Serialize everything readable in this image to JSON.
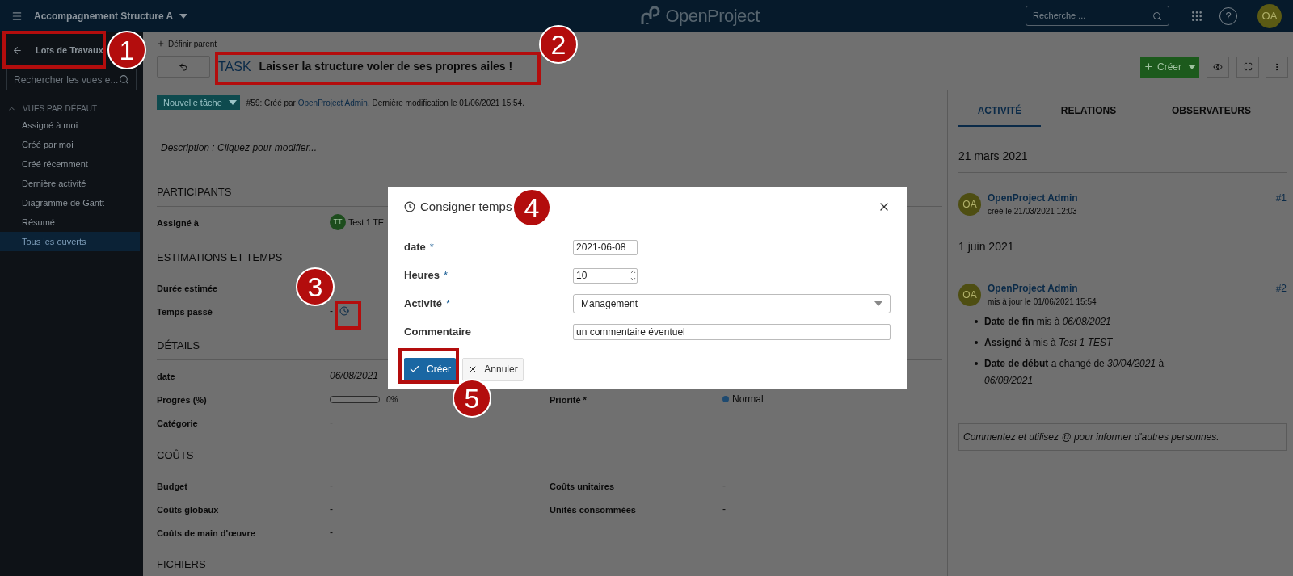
{
  "header": {
    "project": "Accompagnement Structure A",
    "logo_text": "OpenProject",
    "search": {
      "placeholder": "Recherche ..."
    },
    "help": "?",
    "avatar": "OA"
  },
  "sidebar": {
    "title": "Lots de Travaux",
    "search": {
      "placeholder": "Rechercher les vues e..."
    },
    "group": {
      "label": "VUES PAR DÉFAUT",
      "expanded": true
    },
    "items": [
      {
        "label": "Assigné à moi",
        "selected": false
      },
      {
        "label": "Créé par moi",
        "selected": false
      },
      {
        "label": "Créé récemment",
        "selected": false
      },
      {
        "label": "Dernière activité",
        "selected": false
      },
      {
        "label": "Diagramme de Gantt",
        "selected": false
      },
      {
        "label": "Résumé",
        "selected": false
      },
      {
        "label": "Tous les ouverts",
        "selected": true
      }
    ]
  },
  "work_package": {
    "set_parent": "Définir parent",
    "type": "TASK",
    "title": "Laisser la structure voler de ses propres ailes !",
    "create_button": "Créer",
    "status": "Nouvelle tâche",
    "meta_prefix": "#59: Créé par ",
    "meta_author": "OpenProject Admin",
    "meta_suffix": ". Dernière modification le 01/06/2021 15:54.",
    "description": "Description : Cliquez pour modifier...",
    "sections": [
      {
        "title": "PARTICIPANTS",
        "rows": [
          {
            "left": {
              "label": "Assigné à",
              "kind": "user",
              "initials": "TT",
              "value": "Test 1 TE"
            }
          }
        ]
      },
      {
        "title": "ESTIMATIONS ET TEMPS",
        "rows": [
          {
            "left": {
              "label": "Durée estimée",
              "kind": "empty"
            }
          },
          {
            "left": {
              "label": "Temps passé",
              "kind": "time",
              "value": "-"
            }
          }
        ]
      },
      {
        "title": "DÉTAILS",
        "rows": [
          {
            "left": {
              "label": "date",
              "kind": "date",
              "value": "06/08/2021 -"
            }
          },
          {
            "left": {
              "label": "Progrès (%)",
              "kind": "progress",
              "level": 0,
              "reading": "0%"
            },
            "right": {
              "label": "Priorité *",
              "kind": "priority",
              "value": "Normal",
              "color": "#1e4a70"
            }
          },
          {
            "left": {
              "label": "Catégorie",
              "kind": "text",
              "value": "-"
            }
          }
        ]
      },
      {
        "title": "COÛTS",
        "rows": [
          {
            "left": {
              "label": "Budget",
              "kind": "text",
              "value": "-"
            },
            "right": {
              "label": "Coûts unitaires",
              "kind": "text",
              "value": "-"
            }
          },
          {
            "left": {
              "label": "Coûts globaux",
              "kind": "text",
              "value": "-"
            },
            "right": {
              "label": "Unités consommées",
              "kind": "text",
              "value": "-"
            }
          },
          {
            "left": {
              "label": "Coûts de main d'œuvre",
              "kind": "text",
              "value": "-"
            }
          }
        ]
      },
      {
        "title": "FICHIERS"
      }
    ]
  },
  "activity": {
    "tabs": [
      {
        "label": "ACTIVITÉ",
        "selected": true
      },
      {
        "label": "RELATIONS",
        "selected": false
      },
      {
        "label": "OBSERVATEURS",
        "selected": false
      }
    ],
    "days": [
      {
        "date": "21 mars 2021",
        "entries": [
          {
            "initials": "OA",
            "author": "OpenProject Admin",
            "meta": "créé le 21/03/2021 12:03",
            "number": "#1"
          }
        ]
      },
      {
        "date": "1 juin 2021",
        "entries": [
          {
            "initials": "OA",
            "author": "OpenProject Admin",
            "meta": "mis à jour le 01/06/2021 15:54",
            "number": "#2",
            "changes": [
              "**Date de fin** mis à *06/08/2021*",
              "**Assigné à** mis à *Test 1 TEST*",
              "**Date de début** a changé de *30/04/2021* à *06/08/2021*"
            ]
          }
        ]
      }
    ],
    "comment": {
      "placeholder": "Commentez et utilisez @ pour informer d'autres personnes."
    }
  },
  "modal": {
    "title": "Consigner temps",
    "required_mark": "*",
    "fields": [
      {
        "label": "date",
        "required": true,
        "kind": "date",
        "value": "2021-06-08"
      },
      {
        "label": "Heures",
        "required": true,
        "kind": "number",
        "value": "10"
      },
      {
        "label": "Activité",
        "required": true,
        "kind": "select",
        "value": "Management"
      },
      {
        "label": "Commentaire",
        "required": false,
        "kind": "text",
        "value": "un commentaire éventuel"
      }
    ],
    "submit": "Créer",
    "cancel": "Annuler"
  },
  "annotations": [
    {
      "number": "1"
    },
    {
      "number": "2"
    },
    {
      "number": "3"
    },
    {
      "number": "4"
    },
    {
      "number": "5"
    }
  ]
}
